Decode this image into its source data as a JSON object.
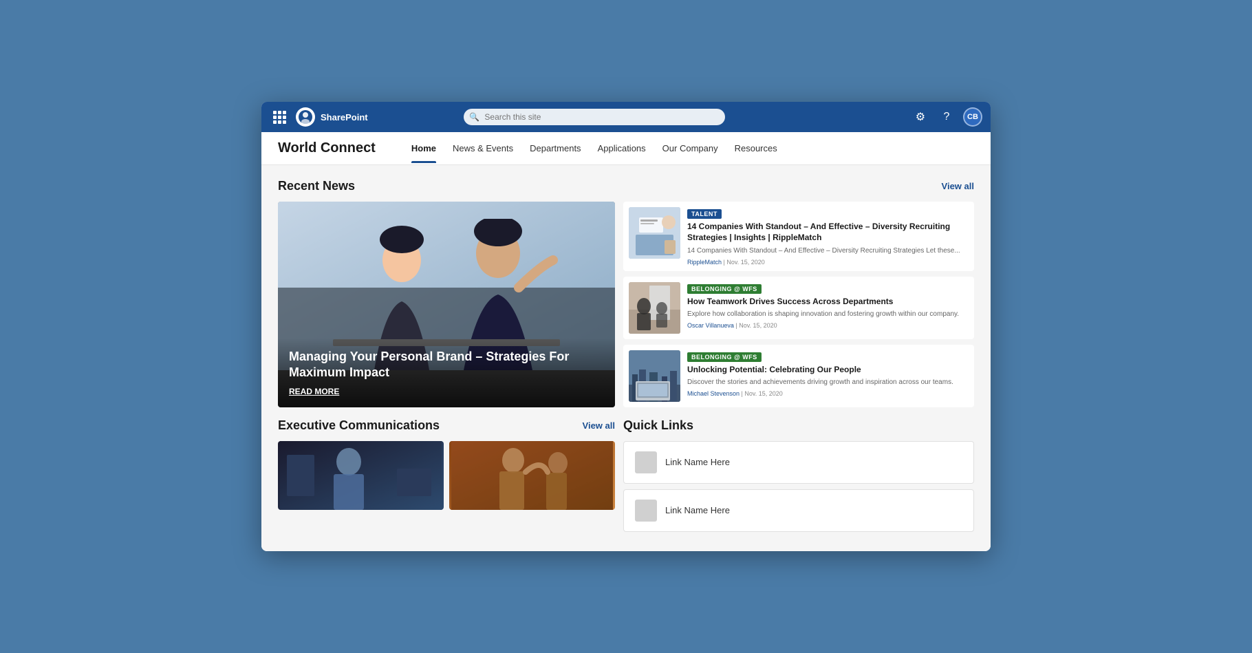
{
  "topbar": {
    "sharepoint_label": "SharePoint",
    "search_placeholder": "Search this site",
    "avatar_initials": "CB"
  },
  "nav": {
    "site_title": "World Connect",
    "links": [
      {
        "label": "Home",
        "active": true
      },
      {
        "label": "News & Events",
        "active": false
      },
      {
        "label": "Departments",
        "active": false
      },
      {
        "label": "Applications",
        "active": false
      },
      {
        "label": "Our Company",
        "active": false
      },
      {
        "label": "Resources",
        "active": false
      }
    ]
  },
  "recent_news": {
    "section_title": "Recent News",
    "view_all_label": "View all",
    "hero": {
      "title": "Managing Your Personal Brand – Strategies For Maximum Impact",
      "read_more": "READ MORE"
    },
    "cards": [
      {
        "tag": "TALENT",
        "tag_class": "tag-talent",
        "title": "14 Companies With Standout – And Effective – Diversity Recruiting Strategies | Insights | RippleMatch",
        "excerpt": "14 Companies With Standout – And Effective – Diversity Recruiting Strategies Let these...",
        "author": "RippleMatch",
        "date": "Nov. 15, 2020",
        "img_class": "news-img-talent"
      },
      {
        "tag": "BELONGING @ WFS",
        "tag_class": "tag-belonging",
        "title": "How Teamwork Drives Success Across Departments",
        "excerpt": "Explore how collaboration is shaping innovation and fostering growth within our company.",
        "author": "Oscar Villanueva",
        "date": "Nov. 15, 2020",
        "img_class": "news-img-team"
      },
      {
        "tag": "BELONGING @ WFS",
        "tag_class": "tag-belonging",
        "title": "Unlocking Potential: Celebrating Our People",
        "excerpt": "Discover the stories and achievements driving growth and inspiration across our teams.",
        "author": "Michael Stevenson",
        "date": "Nov. 15, 2020",
        "img_class": "news-img-unlock"
      }
    ]
  },
  "exec_comms": {
    "section_title": "Executive Communications",
    "view_all_label": "View all"
  },
  "quick_links": {
    "section_title": "Quick Links",
    "items": [
      {
        "label": "Link Name Here"
      },
      {
        "label": "Link Name Here"
      }
    ]
  }
}
